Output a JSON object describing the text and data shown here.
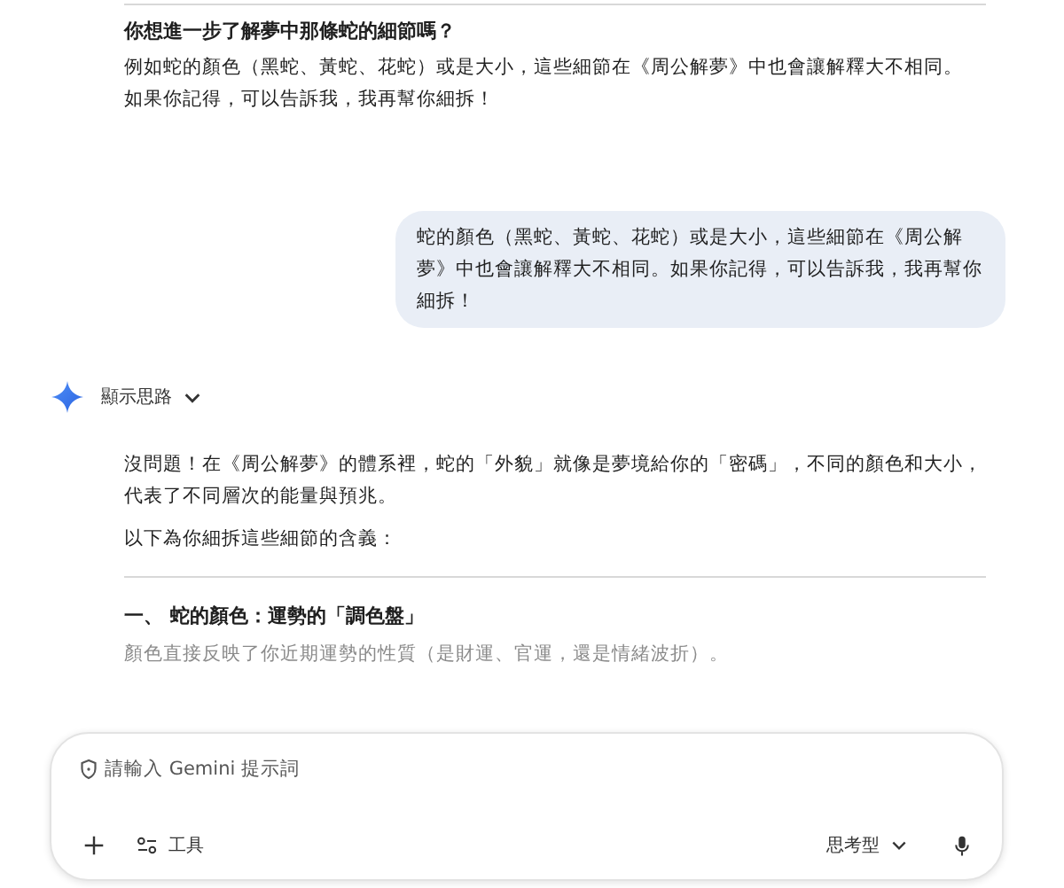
{
  "previous_response": {
    "heading": "你想進一步了解夢中那條蛇的細節嗎？",
    "paragraphs": [
      "例如蛇的顏色（黑蛇、黃蛇、花蛇）或是大小，這些細節在《周公解夢》中也會讓解釋大不相同。",
      "如果你記得，可以告訴我，我再幫你細拆！"
    ]
  },
  "user_message": "蛇的顏色（黑蛇、黃蛇、花蛇）或是大小，這些細節在《周公解夢》中也會讓解釋大不相同。如果你記得，可以告訴我，我再幫你細拆！",
  "thinking_toggle": {
    "label": "顯示思路",
    "expanded": false
  },
  "response": {
    "paragraphs": [
      "沒問題！在《周公解夢》的體系裡，蛇的「外貌」就像是夢境給你的「密碼」，不同的顏色和大小，代表了不同層次的能量與預兆。",
      "以下為你細拆這些細節的含義："
    ],
    "section_heading": "一、 蛇的顏色：運勢的「調色盤」",
    "faded_paragraph": "顏色直接反映了你近期運勢的性質（是財運、官運，還是情緒波折）。"
  },
  "composer": {
    "placeholder": "請輸入 Gemini 提示詞",
    "tools_label": "工具",
    "model_label": "思考型"
  }
}
